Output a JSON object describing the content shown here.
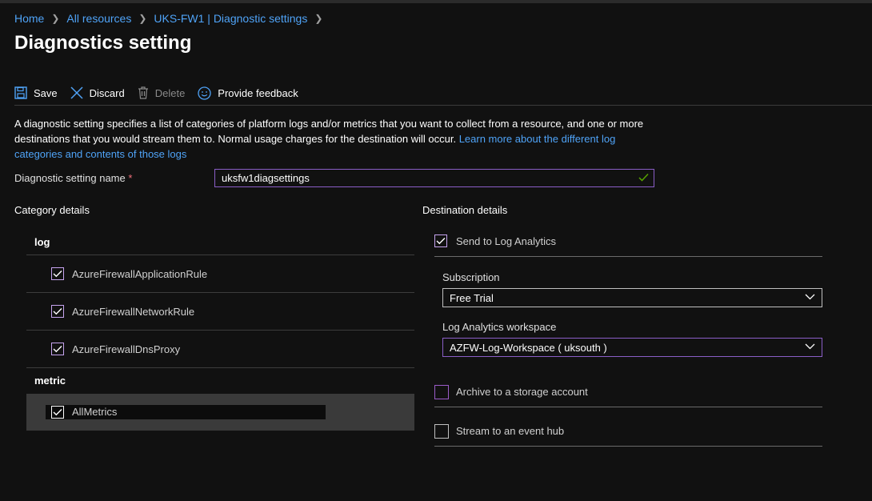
{
  "breadcrumb": {
    "items": [
      "Home",
      "All resources",
      "UKS-FW1 | Diagnostic settings"
    ]
  },
  "page": {
    "title": "Diagnostics setting"
  },
  "toolbar": {
    "save": "Save",
    "discard": "Discard",
    "delete": "Delete",
    "feedback": "Provide feedback"
  },
  "description": {
    "text": "A diagnostic setting specifies a list of categories of platform logs and/or metrics that you want to collect from a resource, and one or more destinations that you would stream them to. Normal usage charges for the destination will occur.",
    "link": "Learn more about the different log categories and contents of those logs"
  },
  "name_field": {
    "label": "Diagnostic setting name",
    "required_mark": "*",
    "value": "uksfw1diagsettings"
  },
  "category": {
    "heading": "Category details",
    "log_heading": "log",
    "logs": [
      {
        "label": "AzureFirewallApplicationRule",
        "checked": true
      },
      {
        "label": "AzureFirewallNetworkRule",
        "checked": true
      },
      {
        "label": "AzureFirewallDnsProxy",
        "checked": true
      }
    ],
    "metric_heading": "metric",
    "metrics": [
      {
        "label": "AllMetrics",
        "checked": true
      }
    ]
  },
  "destination": {
    "heading": "Destination details",
    "log_analytics": {
      "label": "Send to Log Analytics",
      "checked": true
    },
    "subscription": {
      "label": "Subscription",
      "value": "Free Trial"
    },
    "workspace": {
      "label": "Log Analytics workspace",
      "value": "AZFW-Log-Workspace ( uksouth )"
    },
    "storage": {
      "label": "Archive to a storage account",
      "checked": false
    },
    "event_hub": {
      "label": "Stream to an event hub",
      "checked": false
    }
  },
  "colors": {
    "background": "#111111",
    "link": "#4fa3f7",
    "accent": "#8a5ec7",
    "required": "#f1707b",
    "valid": "#57a300"
  }
}
